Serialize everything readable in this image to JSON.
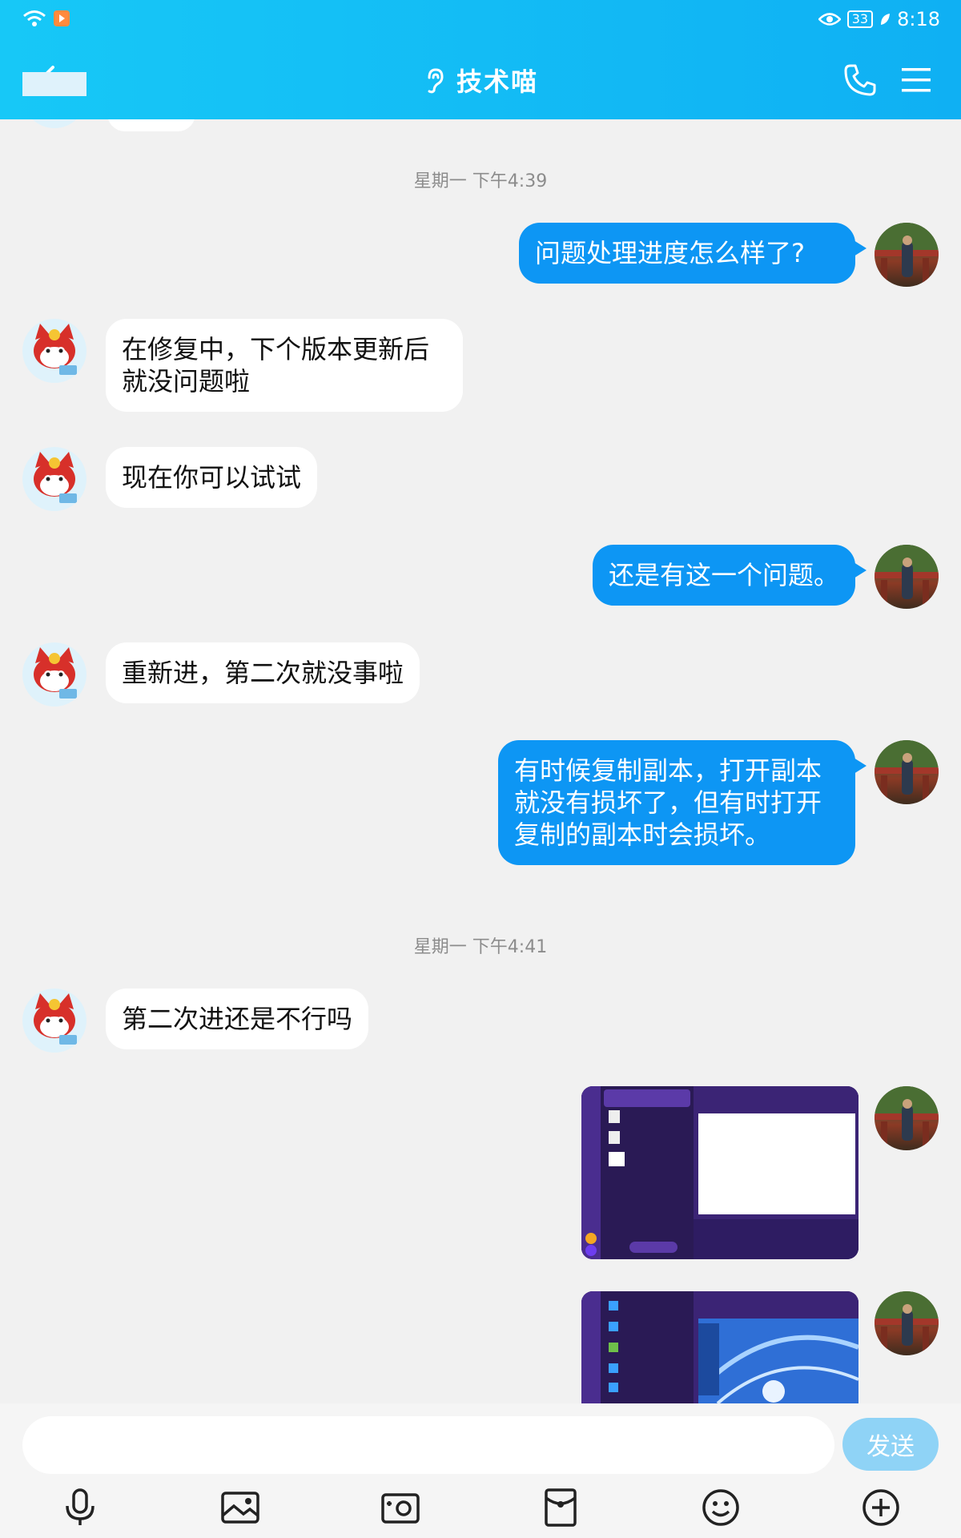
{
  "status_bar": {
    "time": "8:18",
    "battery": "33"
  },
  "header": {
    "title": "技术喵"
  },
  "timestamps": [
    "星期一 下午4:39",
    "星期一 下午4:41"
  ],
  "messages": [
    {
      "side": "out",
      "text": "问题处理进度怎么样了?"
    },
    {
      "side": "in",
      "text": "在修复中，下个版本更新后就没问题啦"
    },
    {
      "side": "in",
      "text": "现在你可以试试"
    },
    {
      "side": "out",
      "text": "还是有这一个问题。"
    },
    {
      "side": "in",
      "text": "重新进，第二次就没事啦"
    },
    {
      "side": "out",
      "text": "有时候复制副本，打开副本就没有损坏了，但有时打开复制的副本时会损坏。"
    },
    {
      "side": "in",
      "text": "第二次进还是不行吗"
    },
    {
      "side": "out",
      "type": "image",
      "description": "screenshot"
    },
    {
      "side": "out",
      "type": "image",
      "description": "screenshot"
    }
  ],
  "input": {
    "placeholder": "",
    "send_label": "发送"
  },
  "toolbar": [
    "mic-icon",
    "image-icon",
    "camera-icon",
    "red-packet-icon",
    "emoji-icon",
    "plus-icon"
  ],
  "colors": {
    "header": "#13bdf5",
    "bubble_out": "#0d96f4",
    "bubble_in": "#ffffff",
    "send_disabled": "#8fd3f6"
  }
}
